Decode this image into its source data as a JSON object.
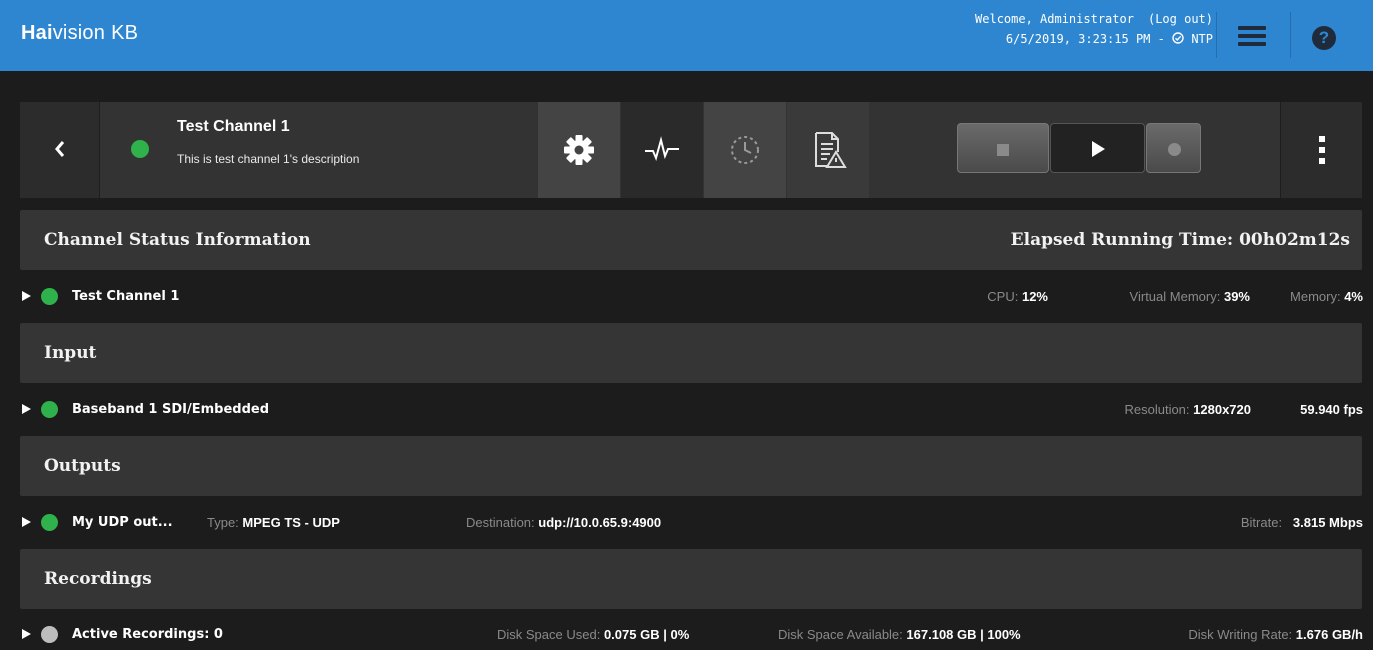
{
  "header": {
    "logo_brand": "Hai",
    "logo_rest": "vision",
    "logo_product": "KB",
    "welcome": "Welcome, Administrator",
    "logout": "(Log out)",
    "datetime": "6/5/2019, 3:23:15 PM - ",
    "ntp": "NTP",
    "help": "?",
    "color": "#2e86d1"
  },
  "channel": {
    "name": "Test Channel 1",
    "description": "This is test channel 1's description",
    "status_color": "#2fb24b"
  },
  "status": {
    "title": "Channel Status Information",
    "elapsed": "Elapsed Running Time: 00h02m12s",
    "row": {
      "name": "Test Channel 1",
      "cpu_label": "CPU:",
      "cpu_value": "12%",
      "vmem_label": "Virtual Memory:",
      "vmem_value": "39%",
      "mem_label": "Memory:",
      "mem_value": "4%"
    }
  },
  "input": {
    "title": "Input",
    "row": {
      "name": "Baseband 1 SDI/Embedded",
      "res_label": "Resolution:",
      "res_value": "1280x720",
      "fps": "59.940 fps"
    }
  },
  "outputs": {
    "title": "Outputs",
    "row": {
      "name": "My UDP out...",
      "type_label": "Type:",
      "type_value": "MPEG TS - UDP",
      "dest_label": "Destination:",
      "dest_value": "udp://10.0.65.9:4900",
      "bitrate_label": "Bitrate:",
      "bitrate_value": "3.815 Mbps"
    }
  },
  "recordings": {
    "title": "Recordings",
    "row": {
      "name": "Active Recordings: 0",
      "used_label": "Disk Space Used:",
      "used_value": "0.075 GB | 0%",
      "avail_label": "Disk Space Available:",
      "avail_value": "167.108 GB | 100%",
      "rate_label": "Disk Writing Rate:",
      "rate_value": "1.676 GB/h"
    }
  },
  "icons": [
    "chevron-left-icon",
    "gear-icon",
    "pulse-icon",
    "clock-icon",
    "log-warning-icon",
    "stop-icon",
    "play-icon",
    "record-icon",
    "kebab-icon",
    "menu-icon",
    "help-icon",
    "caret-right-icon",
    "check-circle-icon"
  ]
}
